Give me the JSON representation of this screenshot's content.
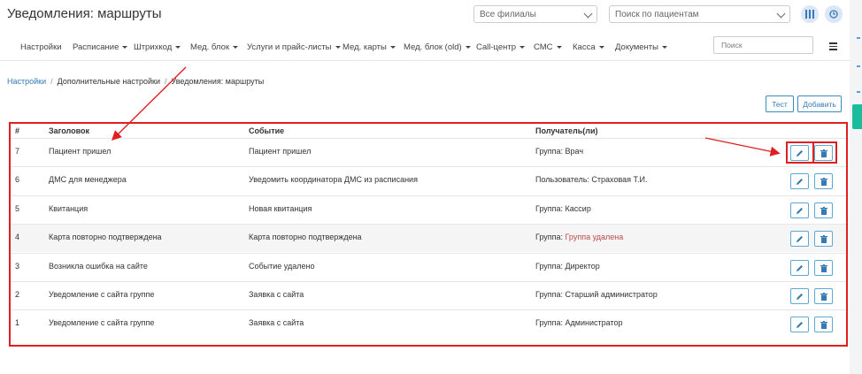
{
  "header": {
    "title": "Уведомления: маршруты",
    "branch_select": "Все филиалы",
    "patient_search_placeholder": "Поиск по пациентам"
  },
  "nav": {
    "items": [
      {
        "label": "Настройки",
        "dropdown": false
      },
      {
        "label": "Расписание",
        "dropdown": true
      },
      {
        "label": "Штрихкод",
        "dropdown": true
      },
      {
        "label": "Мед. блок",
        "dropdown": true
      },
      {
        "label": "Услуги и прайс-листы",
        "dropdown": true
      },
      {
        "label": "Мед. карты",
        "dropdown": true
      },
      {
        "label": "Мед. блок (old)",
        "dropdown": true
      },
      {
        "label": "Call-центр",
        "dropdown": true
      },
      {
        "label": "СМС",
        "dropdown": true
      },
      {
        "label": "Касса",
        "dropdown": true
      },
      {
        "label": "Документы",
        "dropdown": true
      }
    ],
    "search_placeholder": "Поиск"
  },
  "breadcrumb": {
    "root": "Настройки",
    "middle": "Дополнительные настройки",
    "current": "Уведомления: маршруты"
  },
  "toolbar": {
    "test_label": "Тест",
    "add_label": "Добавить"
  },
  "table": {
    "headers": [
      "#",
      "Заголовок",
      "Событие",
      "Получатель(ли)"
    ],
    "rows": [
      {
        "id": "7",
        "title": "Пациент пришел",
        "event": "Пациент пришел",
        "recipient_prefix": "Группа:",
        "recipient": "Врач",
        "removed": false
      },
      {
        "id": "6",
        "title": "ДМС для менеджера",
        "event": "Уведомить координатора ДМС из расписания",
        "recipient_prefix": "Пользователь:",
        "recipient": "Страховая Т.И.",
        "removed": false
      },
      {
        "id": "5",
        "title": "Квитанция",
        "event": "Новая квитанция",
        "recipient_prefix": "Группа:",
        "recipient": "Кассир",
        "removed": false
      },
      {
        "id": "4",
        "title": "Карта повторно подтверждена",
        "event": "Карта повторно подтверждена",
        "recipient_prefix": "Группа:",
        "recipient": "Группа удалена",
        "removed": true
      },
      {
        "id": "3",
        "title": "Возникла ошибка на сайте",
        "event": "Событие удалено",
        "recipient_prefix": "Группа:",
        "recipient": "Директор",
        "removed": false
      },
      {
        "id": "2",
        "title": "Уведомление с сайта группе",
        "event": "Заявка с сайта",
        "recipient_prefix": "Группа:",
        "recipient": "Старший администратор",
        "removed": false
      },
      {
        "id": "1",
        "title": "Уведомление с сайта группе",
        "event": "Заявка с сайта",
        "recipient_prefix": "Группа:",
        "recipient": "Администратор",
        "removed": false
      }
    ]
  },
  "colors": {
    "accent": "#337ab7",
    "button_border": "#5aa9d6",
    "annotation": "#e02020",
    "danger_text": "#b94a48",
    "side_tab": "#1abc9c"
  }
}
